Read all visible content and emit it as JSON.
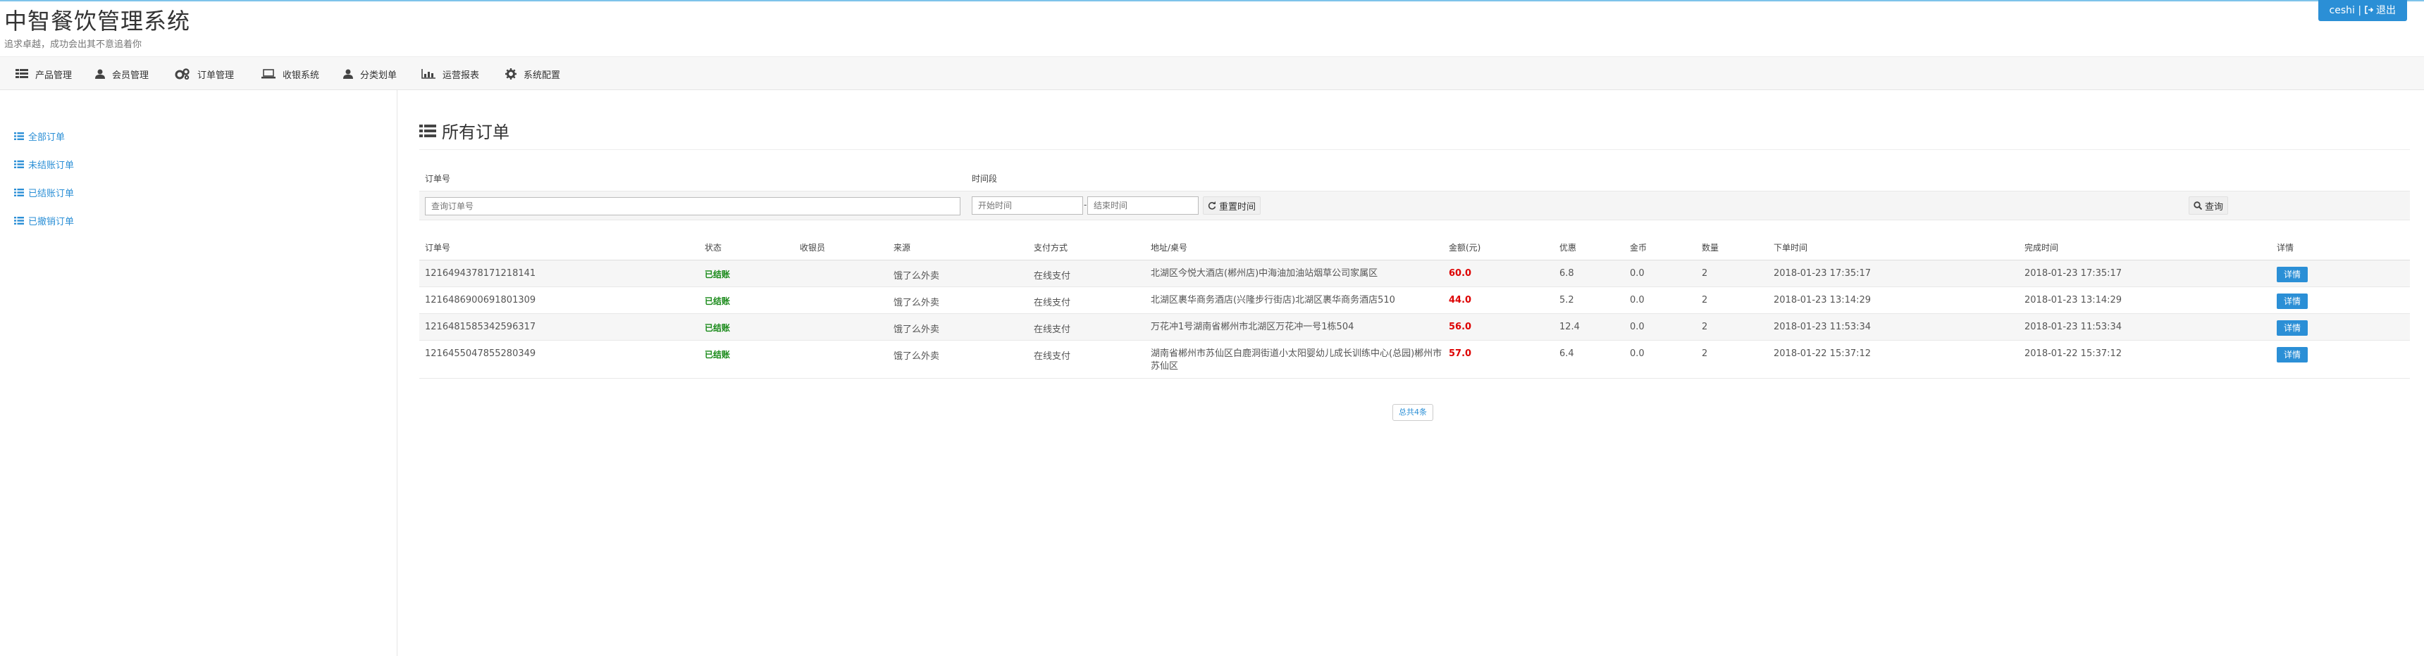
{
  "header": {
    "app_title": "中智餐饮管理系统",
    "slogan": "追求卓越，成功会出其不意追着你",
    "user": "ceshi",
    "separator": "|",
    "logout_label": "退出"
  },
  "nav": {
    "items": [
      {
        "label": "产品管理",
        "icon": "table-icon"
      },
      {
        "label": "会员管理",
        "icon": "user-icon"
      },
      {
        "label": "订单管理",
        "icon": "cogs-icon"
      },
      {
        "label": "收银系统",
        "icon": "laptop-icon"
      },
      {
        "label": "分类划单",
        "icon": "user-icon"
      },
      {
        "label": "运营报表",
        "icon": "bar-chart-icon"
      },
      {
        "label": "系统配置",
        "icon": "gear-icon"
      }
    ]
  },
  "sidebar": {
    "items": [
      {
        "label": "全部订单"
      },
      {
        "label": "未结账订单"
      },
      {
        "label": "已结账订单"
      },
      {
        "label": "已撤销订单"
      }
    ]
  },
  "page": {
    "title": "所有订单"
  },
  "filters": {
    "order_no_label": "订单号",
    "period_label": "时间段",
    "order_no_placeholder": "查询订单号",
    "start_placeholder": "开始时间",
    "end_placeholder": "结束时间",
    "range_dash": "-",
    "reset_label": "重置时间",
    "search_label": "查询"
  },
  "table": {
    "headers": [
      "订单号",
      "状态",
      "收银员",
      "来源",
      "支付方式",
      "地址/桌号",
      "金额(元)",
      "优惠",
      "金币",
      "数量",
      "下单时间",
      "完成时间",
      "详情"
    ],
    "rows": [
      {
        "order_no": "1216494378171218141",
        "status": "已结账",
        "cashier": "",
        "source": "饿了么外卖",
        "payment": "在线支付",
        "address": "北湖区今悦大酒店(郴州店)中海油加油站烟草公司家属区",
        "amount": "60.0",
        "discount": "6.8",
        "coins": "0.0",
        "qty": "2",
        "order_time": "2018-01-23 17:35:17",
        "finish_time": "2018-01-23 17:35:17",
        "detail": "详情"
      },
      {
        "order_no": "1216486900691801309",
        "status": "已结账",
        "cashier": "",
        "source": "饿了么外卖",
        "payment": "在线支付",
        "address": "北湖区裹华商务酒店(兴隆步行街店)北湖区裹华商务酒店510",
        "amount": "44.0",
        "discount": "5.2",
        "coins": "0.0",
        "qty": "2",
        "order_time": "2018-01-23 13:14:29",
        "finish_time": "2018-01-23 13:14:29",
        "detail": "详情"
      },
      {
        "order_no": "1216481585342596317",
        "status": "已结账",
        "cashier": "",
        "source": "饿了么外卖",
        "payment": "在线支付",
        "address": "万花冲1号湖南省郴州市北湖区万花冲一号1栋504",
        "amount": "56.0",
        "discount": "12.4",
        "coins": "0.0",
        "qty": "2",
        "order_time": "2018-01-23 11:53:34",
        "finish_time": "2018-01-23 11:53:34",
        "detail": "详情"
      },
      {
        "order_no": "1216455047855280349",
        "status": "已结账",
        "cashier": "",
        "source": "饿了么外卖",
        "payment": "在线支付",
        "address": "湖南省郴州市苏仙区白鹿洞街道小太阳婴幼儿成长训练中心(总园)郴州市苏仙区",
        "amount": "57.0",
        "discount": "6.4",
        "coins": "0.0",
        "qty": "2",
        "order_time": "2018-01-22 15:37:12",
        "finish_time": "2018-01-22 15:37:12",
        "detail": "详情"
      }
    ]
  },
  "pagination": {
    "total_label": "总共4条"
  },
  "colors": {
    "accent": "#2b8fd6",
    "status_paid": "#1a8a1a",
    "amount": "#dd0000"
  }
}
